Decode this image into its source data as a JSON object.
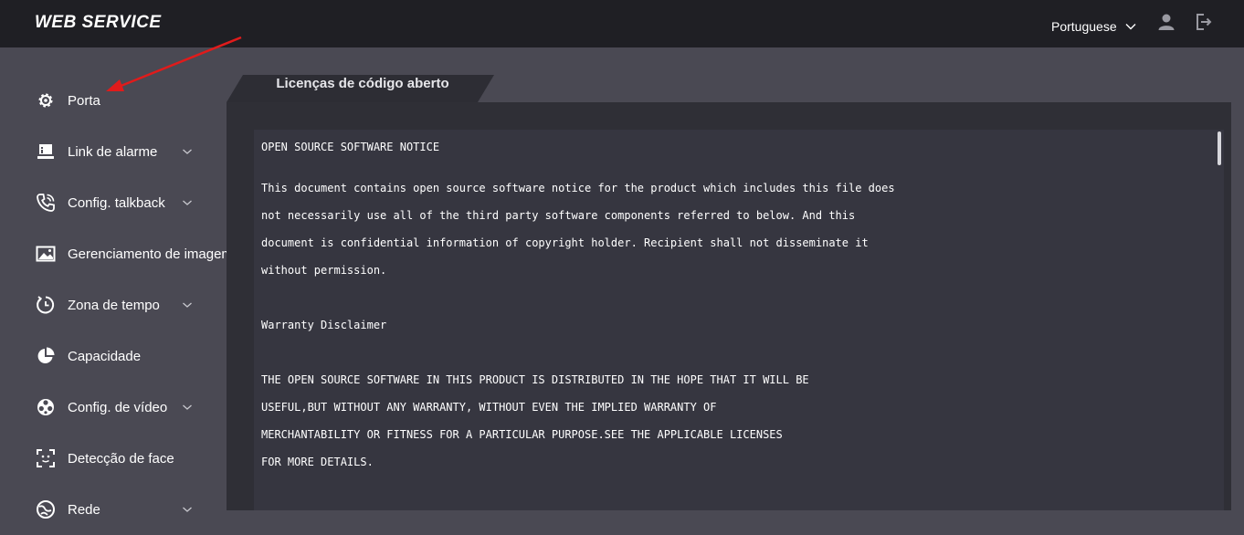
{
  "header": {
    "brand": "WEB SERVICE",
    "language": "Portuguese",
    "icons": [
      "user-icon",
      "logout-icon"
    ]
  },
  "sidebar": {
    "items": [
      {
        "label": "Porta",
        "icon": "gear-icon",
        "has_submenu": false
      },
      {
        "label": "Link de alarme",
        "icon": "alarm-link-icon",
        "has_submenu": true
      },
      {
        "label": "Config. talkback",
        "icon": "phone-icon",
        "has_submenu": true
      },
      {
        "label": "Gerenciamento de imagem",
        "icon": "image-icon",
        "has_submenu": false
      },
      {
        "label": "Zona de tempo",
        "icon": "clock-icon",
        "has_submenu": true
      },
      {
        "label": "Capacidade",
        "icon": "pie-chart-icon",
        "has_submenu": false
      },
      {
        "label": "Config. de vídeo",
        "icon": "film-reel-icon",
        "has_submenu": true
      },
      {
        "label": "Detecção de face",
        "icon": "face-detect-icon",
        "has_submenu": false
      },
      {
        "label": "Rede",
        "icon": "network-globe-icon",
        "has_submenu": true
      }
    ]
  },
  "tab": {
    "label": "Licenças de código aberto"
  },
  "document": {
    "lines": [
      "OPEN SOURCE SOFTWARE NOTICE",
      "This document contains open source software notice for the product which includes this file does",
      "not necessarily use all of the third party software components referred to below. And this",
      "document is confidential information of copyright holder. Recipient shall not disseminate it",
      "without permission.",
      "Warranty Disclaimer",
      "THE OPEN SOURCE SOFTWARE IN THIS PRODUCT IS DISTRIBUTED IN THE HOPE THAT IT WILL BE",
      "USEFUL,BUT WITHOUT ANY WARRANTY, WITHOUT EVEN THE IMPLIED WARRANTY OF",
      "MERCHANTABILITY OR FITNESS FOR A PARTICULAR PURPOSE.SEE THE APPLICABLE LICENSES",
      "FOR MORE DETAILS."
    ]
  },
  "colors": {
    "topbar": "#1f1f24",
    "sidebar": "#4a4953",
    "panel": "#2f2f36",
    "content": "#363640",
    "annotation_arrow": "#e01b1b"
  }
}
